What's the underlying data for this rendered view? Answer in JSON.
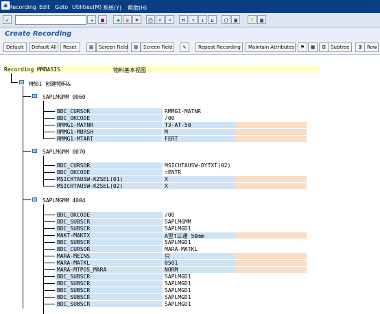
{
  "menubar": {
    "items": [
      "Recording",
      "Edit",
      "Goto",
      "Utilities(M)",
      "系统(Y)",
      "帮助(H)"
    ]
  },
  "title": "Create Recording",
  "buttons": {
    "default": "Default",
    "default_all": "Default All",
    "reset": "Reset",
    "screen_field1": "Screen Field",
    "screen_field2": "Screen Field",
    "repeat": "Repeat Recording",
    "maintain": "Maintain Attributes",
    "subtree": "Subtree",
    "row": "Row"
  },
  "recording": {
    "label": "Recording MMBASIS",
    "desc": "物料基本视图",
    "tcode_node": "MM01 创建物料&"
  },
  "screens": [
    {
      "name": "SAPLMGMM 0060",
      "rows": [
        {
          "field": "BDC_CURSOR",
          "value": "RMMG1-MATNR",
          "orange": false
        },
        {
          "field": "BDC_OKCODE",
          "value": "/00",
          "orange": false
        },
        {
          "field": "RMMG1-MATNR",
          "value": "T3-AT-50",
          "orange": true
        },
        {
          "field": "RMMG1-MBRSH",
          "value": "M",
          "orange": true
        },
        {
          "field": "RMMG1-MTART",
          "value": "FERT",
          "orange": true
        }
      ]
    },
    {
      "name": "SAPLMGMM 0070",
      "rows": [
        {
          "field": "BDC_CURSOR",
          "value": "MSICHTAUSW-DYTXT(02)",
          "orange": false
        },
        {
          "field": "BDC_OKCODE",
          "value": "=ENTR",
          "orange": false
        },
        {
          "field": "MSICHTAUSW-KZSEL(01)",
          "value": "X",
          "orange": true
        },
        {
          "field": "MSICHTAUSW-KZSEL(02)",
          "value": "X",
          "orange": true
        }
      ]
    },
    {
      "name": "SAPLMGMM 4004",
      "rows": [
        {
          "field": "BDC_OKCODE",
          "value": "/00",
          "orange": false
        },
        {
          "field": "BDC_SUBSCR",
          "value": "SAPLMGMM",
          "orange": false
        },
        {
          "field": "BDC_SUBSCR",
          "value": "SAPLMGD1",
          "orange": false
        },
        {
          "field": "MAKT-MAKTX",
          "value": "A型T三通 50mm",
          "orange": true
        },
        {
          "field": "BDC_SUBSCR",
          "value": "SAPLMGD1",
          "orange": false
        },
        {
          "field": "BDC_CURSOR",
          "value": "MARA-MATKL",
          "orange": false
        },
        {
          "field": "MARA-MEINS",
          "value": "只",
          "orange": true
        },
        {
          "field": "MARA-MATKL",
          "value": "0501",
          "orange": true
        },
        {
          "field": "MARA-MTPOS_MARA",
          "value": "NORM",
          "orange": true
        },
        {
          "field": "BDC_SUBSCR",
          "value": "SAPLMGD1",
          "orange": false
        },
        {
          "field": "BDC_SUBSCR",
          "value": "SAPLMGD1",
          "orange": false
        },
        {
          "field": "BDC_SUBSCR",
          "value": "SAPLMGD1",
          "orange": false
        },
        {
          "field": "BDC_SUBSCR",
          "value": "SAPLMGD1",
          "orange": false
        },
        {
          "field": "BDC_SUBSCR",
          "value": "SAPLMGD1",
          "orange": false
        }
      ]
    }
  ]
}
